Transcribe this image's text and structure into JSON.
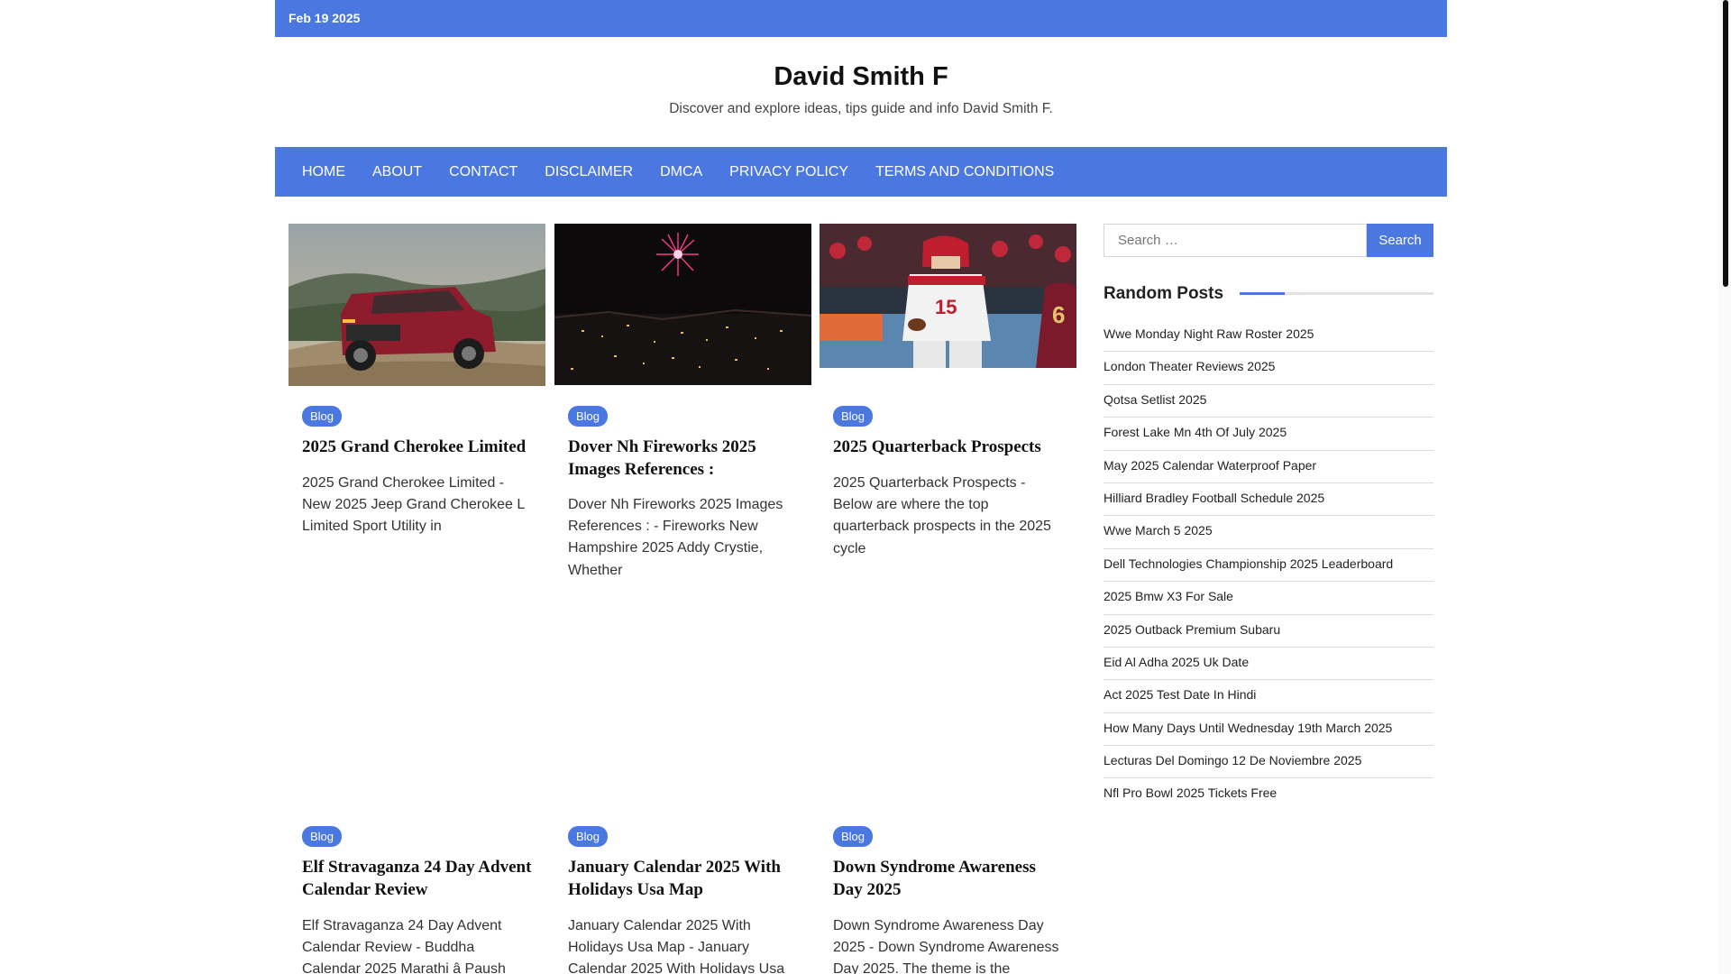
{
  "topbar": {
    "date": "Feb 19 2025"
  },
  "site": {
    "title": "David Smith F",
    "description": "Discover and explore ideas, tips guide and info David Smith F."
  },
  "nav": [
    "HOME",
    "ABOUT",
    "CONTACT",
    "DISCLAIMER",
    "DMCA",
    "PRIVACY POLICY",
    "TERMS AND CONDITIONS"
  ],
  "posts": [
    {
      "category": "Blog",
      "title": "2025 Grand Cherokee Limited",
      "excerpt": "2025 Grand Cherokee Limited - New 2025 Jeep Grand Cherokee L Limited Sport Utility in",
      "image": "red-suv-on-rock-photo"
    },
    {
      "category": "Blog",
      "title": "Dover Nh Fireworks 2025 Images References :",
      "excerpt": "Dover Nh Fireworks 2025 Images References : - Fireworks New Hampshire 2025 Addy Crystie, Whether",
      "image": "fireworks-over-city-photo"
    },
    {
      "category": "Blog",
      "title": "2025 Quarterback Prospects",
      "excerpt": "2025 Quarterback Prospects - Below are where the top quarterback prospects in the 2025 cycle",
      "image": "quarterback-photo"
    },
    {
      "category": "Blog",
      "title": "Elf Stravaganza 24 Day Advent Calendar Review",
      "excerpt": "Elf Stravaganza 24 Day Advent Calendar Review - Buddha Calendar 2025 Marathi â Paush",
      "image": ""
    },
    {
      "category": "Blog",
      "title": "January Calendar 2025 With Holidays Usa Map",
      "excerpt": "January Calendar 2025 With Holidays Usa Map - January Calendar 2025 With Holidays Usa",
      "image": ""
    },
    {
      "category": "Blog",
      "title": "Down Syndrome Awareness Day 2025",
      "excerpt": "Down Syndrome Awareness Day 2025 - Down Syndrome Awareness Day 2025. The theme is the",
      "image": ""
    }
  ],
  "search": {
    "placeholder": "Search …",
    "button_label": "Search"
  },
  "random_posts": {
    "title": "Random Posts",
    "items": [
      "Wwe Monday Night Raw Roster 2025",
      "London Theater Reviews 2025",
      "Qotsa Setlist 2025",
      "Forest Lake Mn 4th Of July 2025",
      "May 2025 Calendar Waterproof Paper",
      "Hilliard Bradley Football Schedule 2025",
      "Wwe March 5 2025",
      "Dell Technologies Championship 2025 Leaderboard",
      "2025 Bmw X3 For Sale",
      "2025 Outback Premium Subaru",
      "Eid Al Adha 2025 Uk Date",
      "Act 2025 Test Date In Hindi",
      "How Many Days Until Wednesday 19th March 2025",
      "Lecturas Del Domingo 12 De Noviembre 2025",
      "Nfl Pro Bowl 2025 Tickets Free"
    ]
  },
  "colors": {
    "accent": "#4a78e0",
    "text": "#111111",
    "muted": "#333333",
    "divider": "#dcdcdc"
  }
}
